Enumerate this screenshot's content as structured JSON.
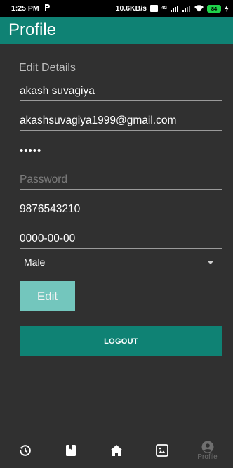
{
  "status": {
    "time": "1:25 PM",
    "net_speed": "10.6KB/s",
    "network_type": "4G",
    "battery": "84"
  },
  "appbar": {
    "title": "Profile"
  },
  "form": {
    "section_title": "Edit Details",
    "name_value": "akash suvagiya",
    "email_value": "akashsuvagiya1999@gmail.com",
    "password_dots": "•••••",
    "password_placeholder": "Password",
    "phone_value": "9876543210",
    "dob_value": "0000-00-00",
    "gender_selected": "Male"
  },
  "buttons": {
    "edit": "Edit",
    "logout": "LOGOUT"
  },
  "bottom_nav": [
    {
      "icon": "history-icon",
      "label": ""
    },
    {
      "icon": "book-icon",
      "label": ""
    },
    {
      "icon": "home-icon",
      "label": ""
    },
    {
      "icon": "gallery-icon",
      "label": ""
    },
    {
      "icon": "account-circle-icon",
      "label": "Profile"
    }
  ],
  "colors": {
    "primary": "#0f8274",
    "edit_button": "#73c6bd",
    "background": "#303030"
  }
}
